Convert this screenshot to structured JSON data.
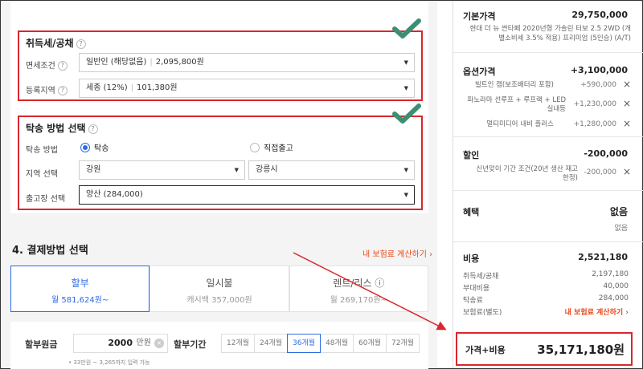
{
  "tax": {
    "title": "취득세/공채",
    "help": "?",
    "exemption_label": "면세조건",
    "exemption_value": "일반인 (해당없음)",
    "exemption_amount": "2,095,800원",
    "region_label": "등록지역",
    "region_value": "세종 (12%)",
    "region_amount": "101,380원"
  },
  "delivery": {
    "title": "탁송 방법 선택",
    "help": "?",
    "method_label": "탁송 방법",
    "option_delivery": "탁송",
    "option_pickup": "직접출고",
    "area_label": "지역 선택",
    "area_province": "강원",
    "area_city": "강릉시",
    "center_label": "출고장 선택",
    "center_value": "양산 (284,000)"
  },
  "payment": {
    "title": "4. 결제방법 선택",
    "insurance_link": "내 보험료 계산하기 ›",
    "tabs": [
      {
        "label": "할부",
        "sub": "월 581,624원~"
      },
      {
        "label": "일시불",
        "sub": "캐시백 357,000원"
      },
      {
        "label": "렌트/리스 ⓘ",
        "sub": "월 269,170원~"
      }
    ],
    "principal_label": "할부원금",
    "principal_value": "2000",
    "principal_unit": "만원",
    "principal_clear": "×",
    "period_label": "할부기간",
    "months": [
      "12개월",
      "24개월",
      "36개월",
      "48개월",
      "60개월",
      "72개월"
    ],
    "active_month_index": 2,
    "hint": "• 33만원 ~ 3,265까지 입력 가능"
  },
  "summary": {
    "base": {
      "label": "기본가격",
      "value": "29,750,000",
      "desc_line1": "현대 더 뉴 싼타페 2020년형 가솔린 터보 2.5 2WD (개",
      "desc_line2": "별소비세 3.5% 적용) 프리미엄 (5인승) (A/T)"
    },
    "options": {
      "label": "옵션가격",
      "value": "+3,100,000",
      "items": [
        {
          "name_line1": "빌트인 캠(보조배터리 포함)",
          "name_line2": "",
          "price": "+590,000"
        },
        {
          "name_line1": "파노라마 선루프 + 루프랙 + LED",
          "name_line2": "실내등",
          "price": "+1,230,000"
        },
        {
          "name_line1": "멀티미디어 내비 플러스",
          "name_line2": "",
          "price": "+1,280,000"
        }
      ],
      "remove_icon": "×"
    },
    "discount": {
      "label": "할인",
      "value": "-200,000",
      "item_line1": "신년맞이 기간 조건(20년 생산 재고",
      "item_line2": "한정)",
      "item_price": "-200,000"
    },
    "benefit": {
      "label": "혜택",
      "value": "없음",
      "sub": "없음"
    },
    "cost": {
      "label": "비용",
      "value": "2,521,180",
      "rows": [
        {
          "name": "취득세/공채",
          "value": "2,197,180"
        },
        {
          "name": "부대비용",
          "value": "40,000"
        },
        {
          "name": "탁송료",
          "value": "284,000"
        },
        {
          "name": "보험료(별도)",
          "value": "내 보험료 계산하기 ›"
        }
      ]
    },
    "total": {
      "label": "가격+비용",
      "value": "35,171,180원"
    }
  },
  "colors": {
    "accent_blue": "#2d6be4",
    "highlight_red": "#d9262e",
    "check_green": "#3d8f73",
    "link_orange": "#e8491d"
  }
}
